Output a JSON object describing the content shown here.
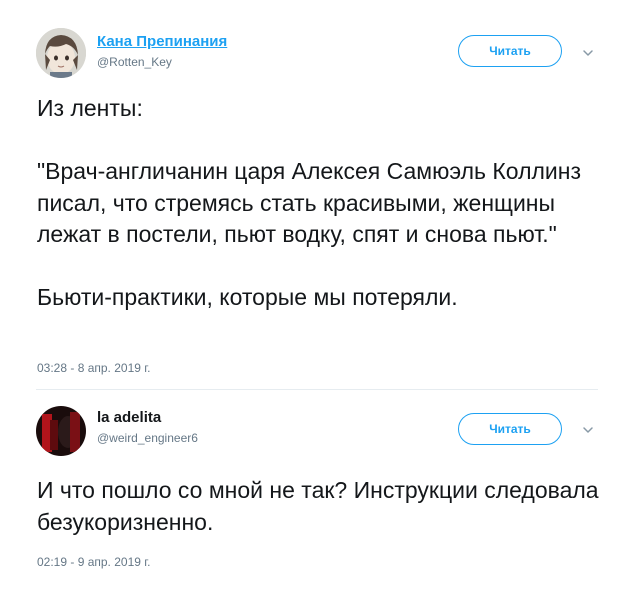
{
  "tweets": [
    {
      "display_name": "Кана Препинания",
      "handle": "@Rotten_Key",
      "follow_label": "Читать",
      "text": "Из ленты:\n\n\"Врач-англичанин царя Алексея Самюэль Коллинз писал, что стремясь стать красивыми, женщины лежат в постели, пьют водку, спят и снова пьют.\"\n\nБьюти-практики, которые мы потеряли.",
      "timestamp": "03:28 - 8 апр. 2019 г."
    },
    {
      "display_name": "la adelita",
      "handle": "@weird_engineer6",
      "follow_label": "Читать",
      "text": "И что пошло со мной не так? Инструкции следовала безукоризненно.",
      "timestamp": "02:19 - 9 апр. 2019 г."
    }
  ],
  "colors": {
    "accent": "#1da1f2",
    "text": "#14171a",
    "secondary": "#657786",
    "divider": "#e6ecf0"
  },
  "icons": [
    "chevron-down-icon"
  ]
}
